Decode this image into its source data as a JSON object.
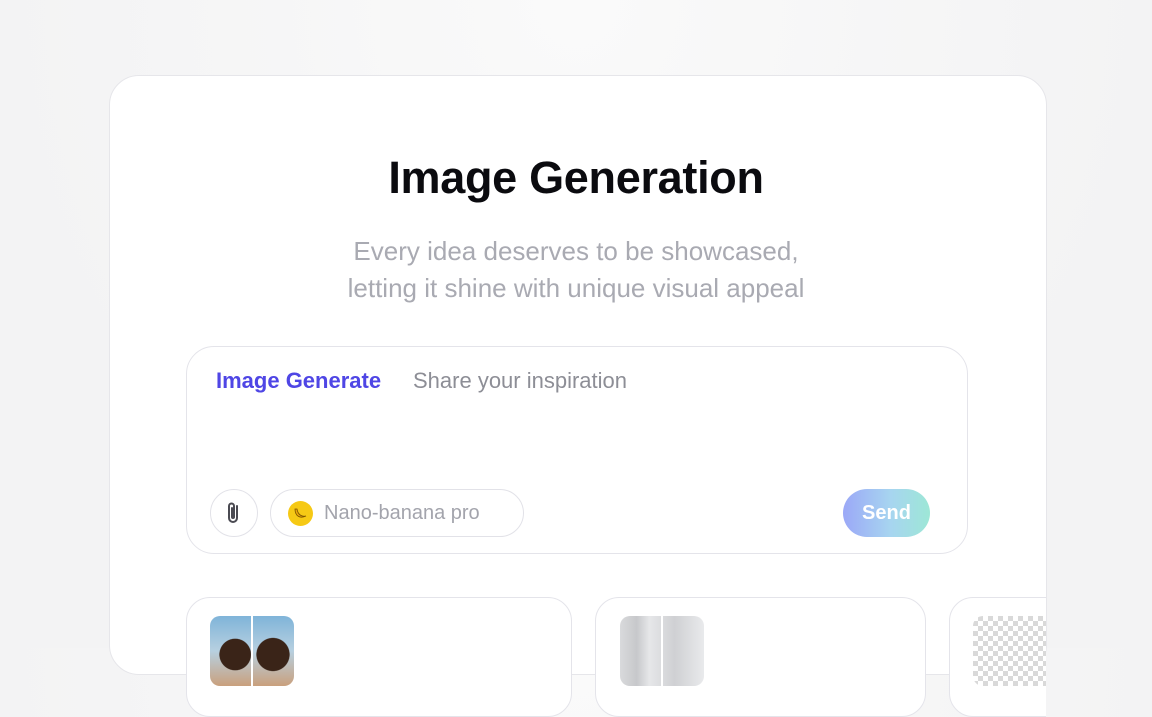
{
  "hero": {
    "title": "Image Generation",
    "subtitle_line1": "Every idea deserves to be showcased,",
    "subtitle_line2": "letting it shine with unique visual appeal"
  },
  "prompt": {
    "mode_label": "Image Generate",
    "placeholder": "Share your inspiration",
    "attach_icon": "paperclip-icon",
    "model_icon": "banana-icon",
    "model_label": "Nano-banana pro",
    "send_label": "Send"
  },
  "colors": {
    "accent": "#4f46e5",
    "model_icon_bg": "#f6c915",
    "send_gradient_start": "#9ba8f7",
    "send_gradient_end": "#9de7d6"
  }
}
